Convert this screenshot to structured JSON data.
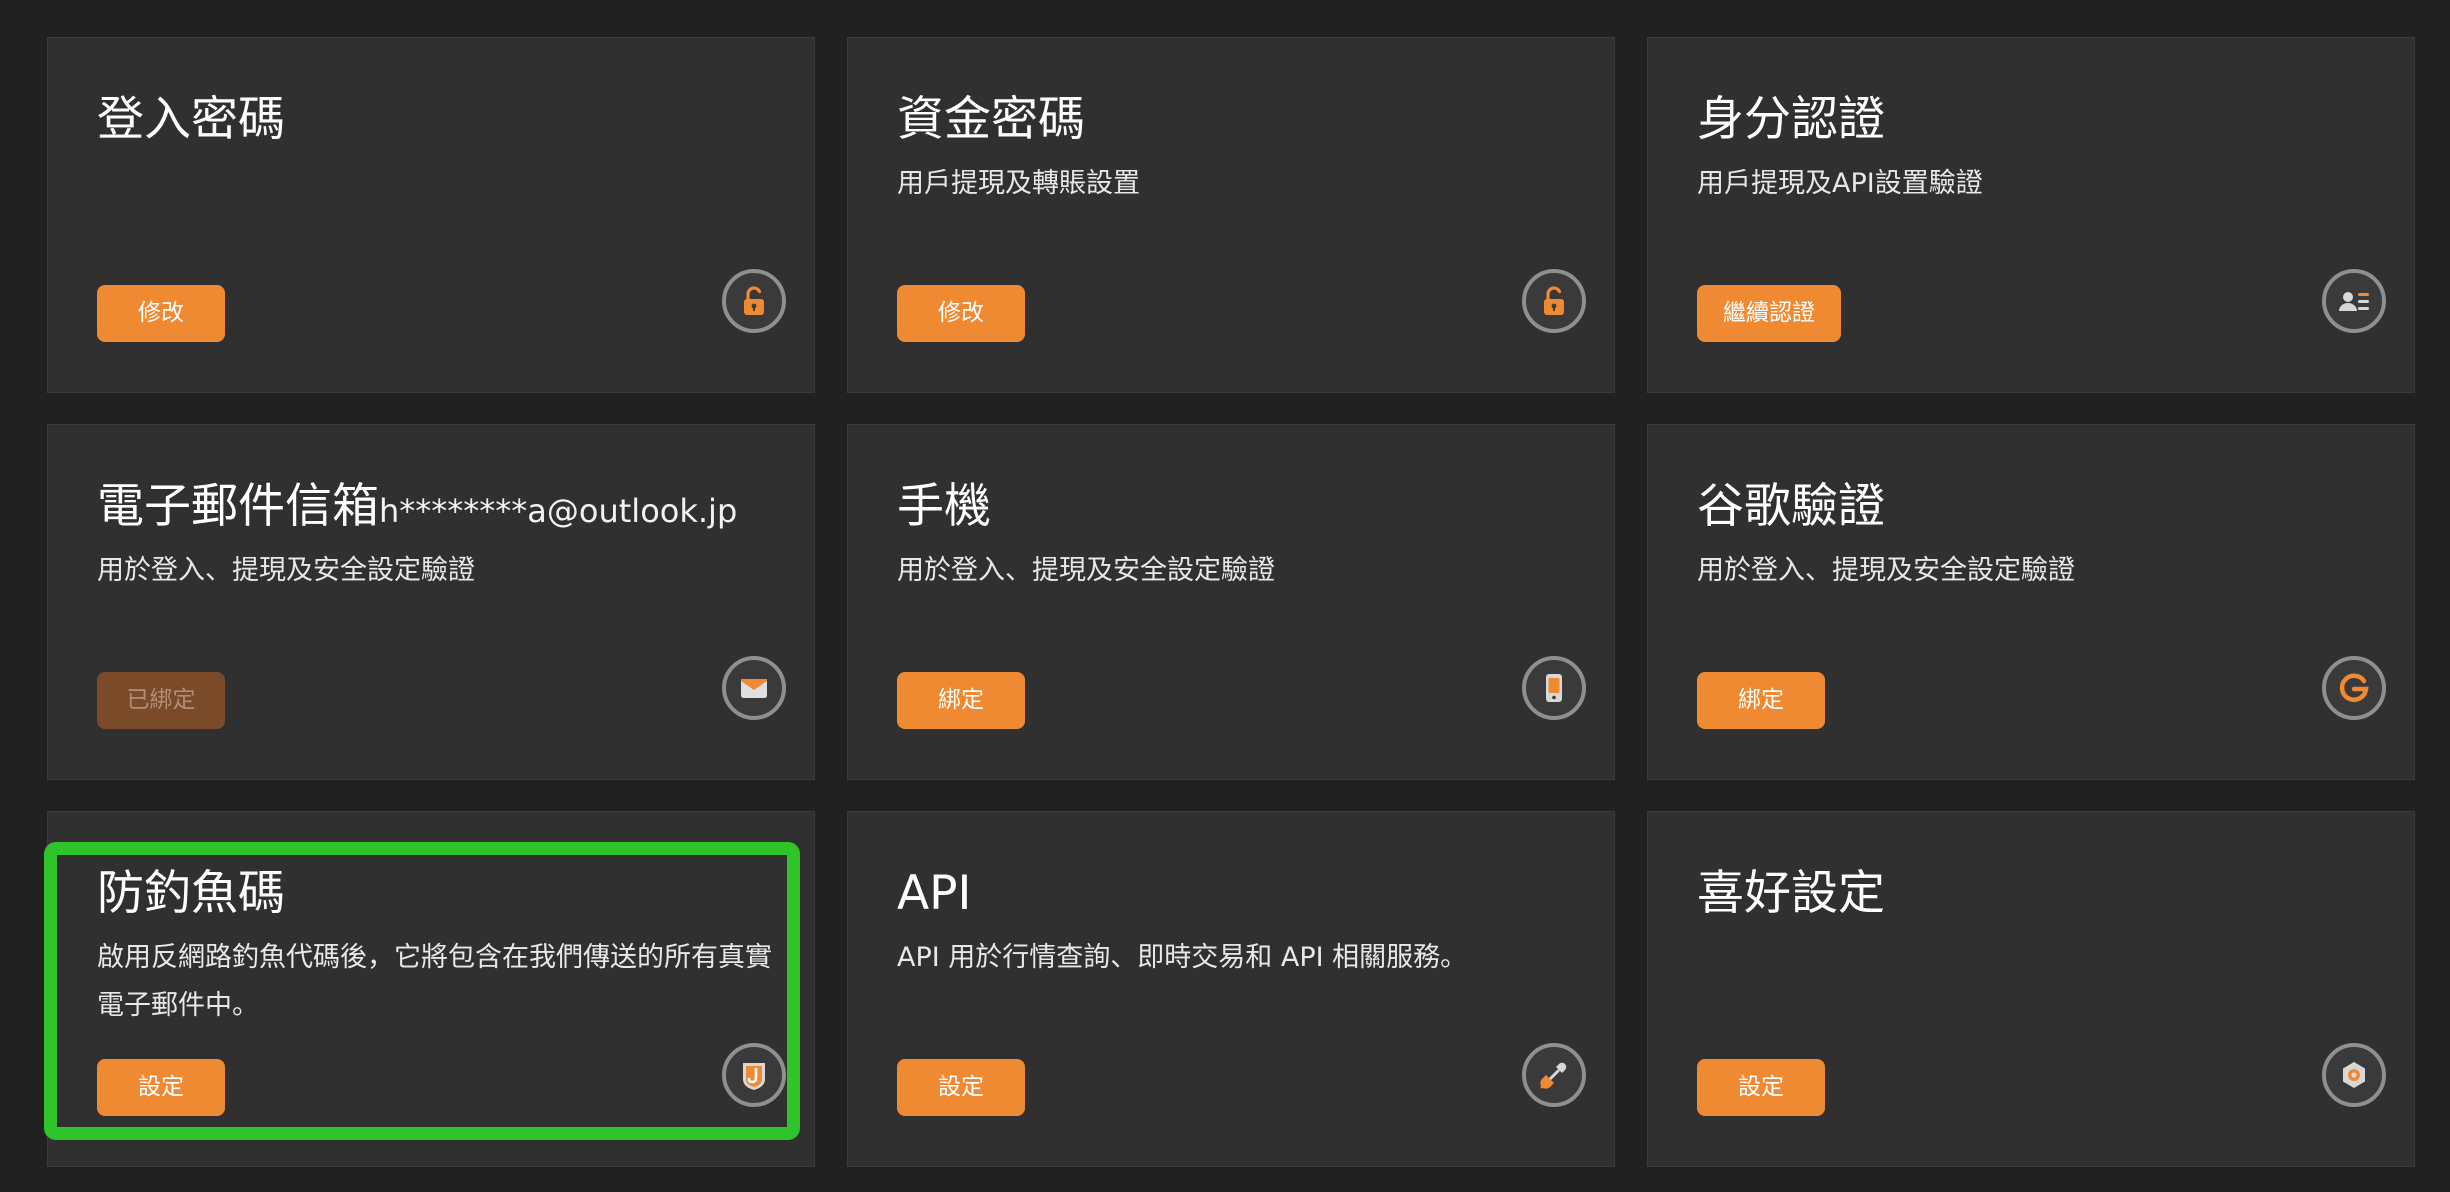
{
  "accent_color": "#f08a32",
  "cards": [
    {
      "title": "登入密碼",
      "desc": "",
      "button": "修改",
      "icon": "lock-icon"
    },
    {
      "title": "資金密碼",
      "desc": "用戶提現及轉賬設置",
      "button": "修改",
      "icon": "lock-icon"
    },
    {
      "title": "身分認證",
      "desc": "用戶提現及API設置驗證",
      "button": "繼續認證",
      "icon": "id-card-icon"
    },
    {
      "title": "電子郵件信箱",
      "email": "h********a@outlook.jp",
      "desc": "用於登入、提現及安全設定驗證",
      "button": "已綁定",
      "icon": "mail-icon"
    },
    {
      "title": "手機",
      "desc": "用於登入、提現及安全設定驗證",
      "button": "綁定",
      "icon": "phone-icon"
    },
    {
      "title": "谷歌驗證",
      "desc": "用於登入、提現及安全設定驗證",
      "button": "綁定",
      "icon": "google-icon"
    },
    {
      "title": "防釣魚碼",
      "desc": "啟用反網路釣魚代碼後，它將包含在我們傳送的所有真實電子郵件中。",
      "button": "設定",
      "icon": "shield-icon"
    },
    {
      "title": "API",
      "desc": "API 用於行情查詢、即時交易和 API 相關服務。",
      "button": "設定",
      "icon": "plug-icon"
    },
    {
      "title": "喜好設定",
      "desc": "",
      "button": "設定",
      "icon": "settings-icon"
    }
  ]
}
